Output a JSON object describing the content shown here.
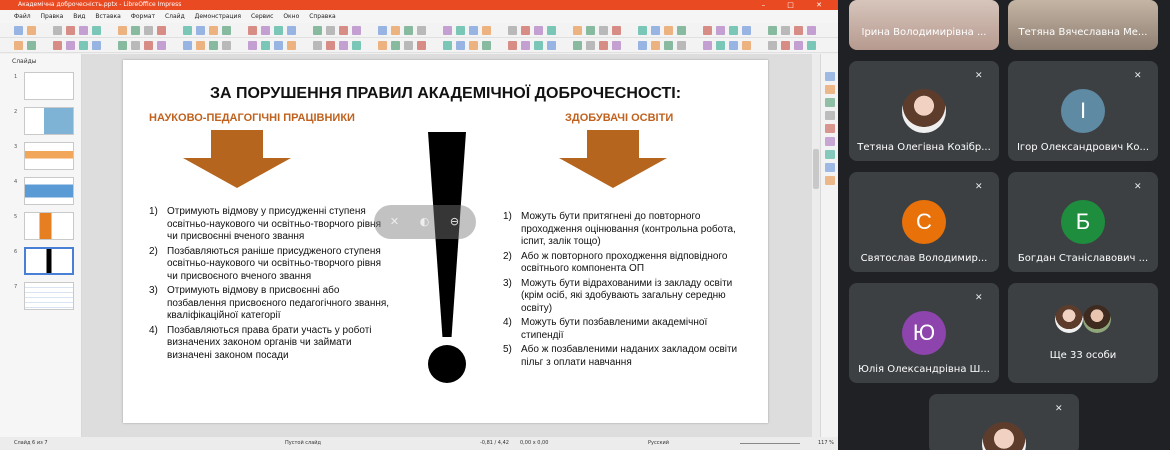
{
  "impress": {
    "title": "Академічна доброчесність.pptx - LibreOffice Impress",
    "window_controls": "–  □  ✕",
    "menu": [
      "Файл",
      "Правка",
      "Вид",
      "Вставка",
      "Формат",
      "Слайд",
      "Демонстрация",
      "Сервис",
      "Окно",
      "Справка"
    ],
    "sidebar_label": "Слайды",
    "slide_numbers": [
      "1",
      "2",
      "3",
      "4",
      "5",
      "6",
      "7"
    ],
    "selected_slide": 6,
    "status": {
      "slide": "Слайд 6 из 7",
      "layout": "Пустой слайд",
      "coords": "-0,81 / 4,42",
      "size": "0,00 x 0,00",
      "lang": "Русский",
      "zoom": "117 %"
    }
  },
  "slide": {
    "title": "ЗА ПОРУШЕННЯ ПРАВИЛ АКАДЕМІЧНОЇ ДОБРОЧЕСНОСТІ:",
    "left_heading": "НАУКОВО-ПЕДАГОГІЧНІ ПРАЦІВНИКИ",
    "right_heading": "ЗДОБУВАЧІ ОСВІТИ",
    "left_list": [
      {
        "num": "1)",
        "text": "Отримують відмову у присудженні ступеня освітньо-наукового чи освітньо-творчого рівня чи присвоєнні вченого звання"
      },
      {
        "num": "2)",
        "text": "Позбавляються раніше присудженого ступеня освітньо-наукового чи освітньо-творчого рівня чи присвоєного вченого звання"
      },
      {
        "num": "3)",
        "text": "Отримують відмову в присвоєнні або позбавлення присвоєного педагогічного звання, кваліфікаційної категорії"
      },
      {
        "num": "4)",
        "text": "Позбавляються права брати участь у роботі визначених законом органів чи займати визначені законом посади"
      }
    ],
    "right_list": [
      {
        "num": "1)",
        "text": "Можуть бути притягнені до повторного проходження оцінювання (контрольна робота, іспит, залік тощо)"
      },
      {
        "num": "2)",
        "text": "Або ж повторного проходження відповідного освітнього компонента ОП"
      },
      {
        "num": "3)",
        "text": "Можуть бути відрахованими із закладу освіти (крім осіб, які здобувають загальну середню освіту)"
      },
      {
        "num": "4)",
        "text": "Можуть бути позбавленими академічної стипендії"
      },
      {
        "num": "5)",
        "text": "Або ж позбавленими наданих закладом освіти пільг з оплати навчання"
      }
    ]
  },
  "participants": [
    {
      "name": "Ірина Володимирівна ...",
      "kind": "video"
    },
    {
      "name": "Тетяна Вячеславна Ме...",
      "kind": "video"
    },
    {
      "name": "Тетяна Олегівна Козібр...",
      "kind": "photo"
    },
    {
      "name": "Ігор Олександрович Ко...",
      "kind": "letter",
      "letter": "І",
      "color": "#5f8aa3"
    },
    {
      "name": "Святослав Володимир...",
      "kind": "letter",
      "letter": "С",
      "color": "#e8710a"
    },
    {
      "name": "Богдан Станіславович ...",
      "kind": "letter",
      "letter": "Б",
      "color": "#1e8e3e"
    },
    {
      "name": "Юлія Олександрівна Ш...",
      "kind": "letter",
      "letter": "Ю",
      "color": "#8e44ad"
    },
    {
      "name": "Ще 33 особи",
      "kind": "more"
    },
    {
      "name": "",
      "kind": "photo"
    }
  ],
  "colors": {
    "accent_orange": "#c0621f",
    "arrow_brown": "#b5651d",
    "meet_tile": "#3c4043",
    "meet_bg": "#202124"
  }
}
